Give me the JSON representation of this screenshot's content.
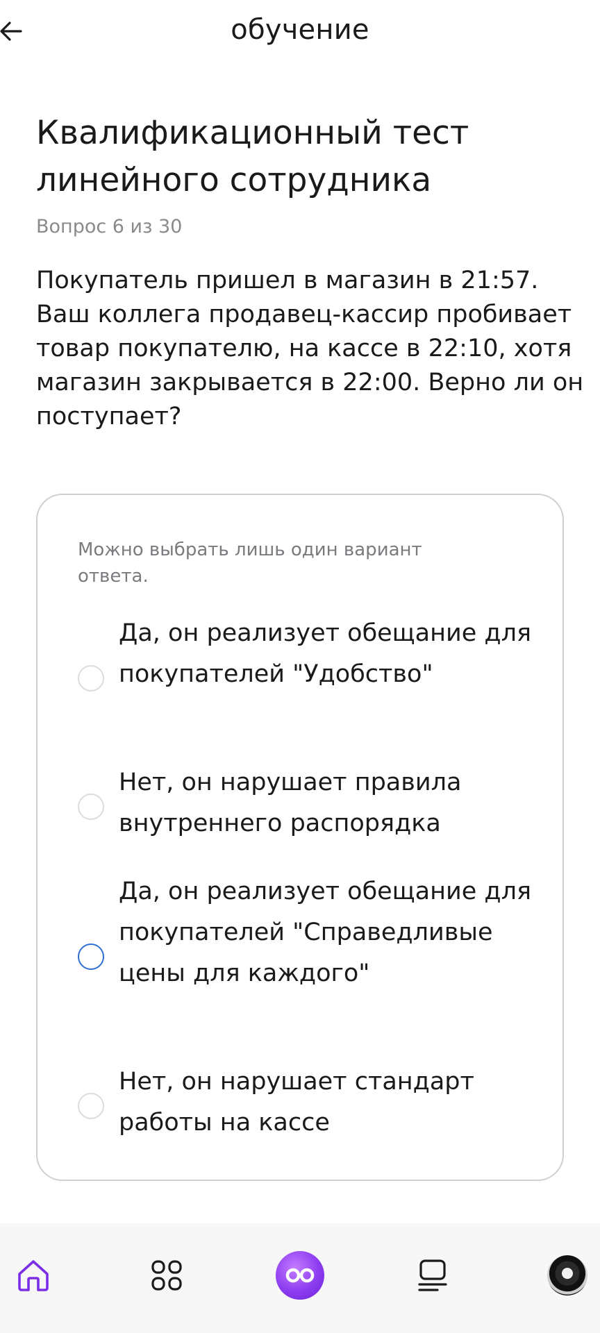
{
  "header": {
    "title": "обучение"
  },
  "test": {
    "title": "Квалификационный тест линейного сотрудника",
    "counter": "Вопрос 6 из 30",
    "question": "Покупатель пришел в магазин в 21:57. Ваш коллега продавец-кассир пробивает товар покупателю, на кассе в 22:10, хотя магазин закрывается в 22:00. Верно ли он поступает?"
  },
  "answers": {
    "hint": "Можно выбрать лишь один вариант ответа.",
    "options": [
      {
        "label": "Да, он реализует обещание для покупателей \"Удобство\""
      },
      {
        "label": "Нет, он нарушает правила внутреннего распорядка"
      },
      {
        "label": "Да, он реализует обещание для покупателей \"Справедливые цены для каждого\""
      },
      {
        "label": "Нет, он нарушает стандарт работы на кассе"
      }
    ]
  },
  "nav": {
    "icons": [
      "home-icon",
      "apps-grid-icon",
      "assistant-infinity-icon",
      "courses-list-icon",
      "profile-avatar"
    ]
  },
  "colors": {
    "accent_purple": "#7a2ee6",
    "focus_blue": "#2e6fd0",
    "nav_background": "#f7f7f8",
    "hint_gray": "#7b7b7f"
  }
}
